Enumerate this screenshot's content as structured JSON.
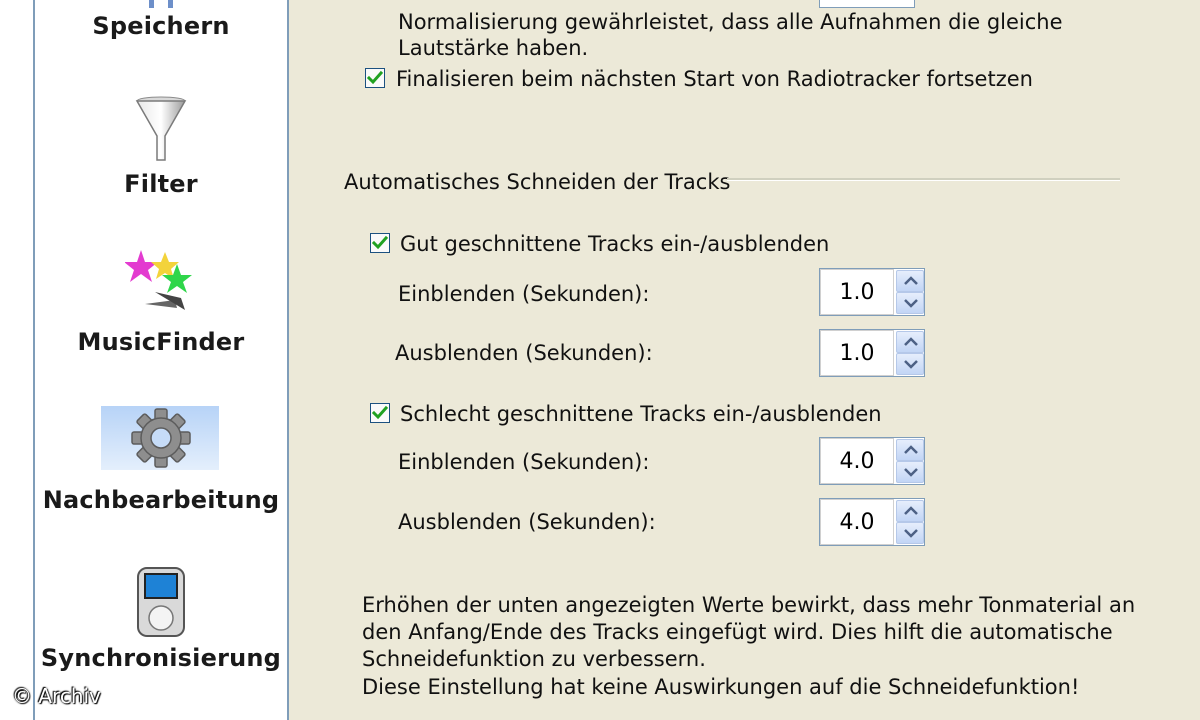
{
  "sidebar": {
    "items": [
      {
        "label": "Speichern",
        "icon": "save-icon"
      },
      {
        "label": "Filter",
        "icon": "funnel-icon"
      },
      {
        "label": "MusicFinder",
        "icon": "stars-icon"
      },
      {
        "label": "Nachbearbeitung",
        "icon": "gear-icon",
        "selected": true
      },
      {
        "label": "Synchronisierung",
        "icon": "media-player-icon"
      }
    ],
    "copyright": "© Archiv"
  },
  "normalize": {
    "line1": "Normalisierung gewährleistet, dass alle Aufnahmen die gleiche",
    "line2": "Lautstärke haben.",
    "finalize_label": "Finalisieren beim nächsten Start von Radiotracker fortsetzen",
    "finalize_checked": true
  },
  "cutting": {
    "group_title": "Automatisches Schneiden der Tracks",
    "good": {
      "label": "Gut geschnittene Tracks ein-/ausblenden",
      "checked": true,
      "fade_in_label": "Einblenden (Sekunden):",
      "fade_in_value": "1.0",
      "fade_out_label": "Ausblenden (Sekunden):",
      "fade_out_value": "1.0"
    },
    "bad": {
      "label": "Schlecht geschnittene Tracks ein-/ausblenden",
      "checked": true,
      "fade_in_label": "Einblenden (Sekunden):",
      "fade_in_value": "4.0",
      "fade_out_label": "Ausblenden (Sekunden):",
      "fade_out_value": "4.0"
    }
  },
  "info": {
    "line1": "Erhöhen der unten angezeigten Werte bewirkt, dass mehr Tonmaterial an",
    "line2": "den Anfang/Ende des Tracks eingefügt wird. Dies hilft die automatische",
    "line3": "Schneidefunktion zu verbessern.",
    "line4": "Diese Einstellung hat keine Auswirkungen auf die Schneidefunktion!"
  },
  "colors": {
    "panel_background": "#ece9d8",
    "sidebar_background": "#ffffff",
    "checkmark": "#21a121",
    "spin_arrow": "#4d6185",
    "selected_highlight": "#b7d3f7"
  }
}
